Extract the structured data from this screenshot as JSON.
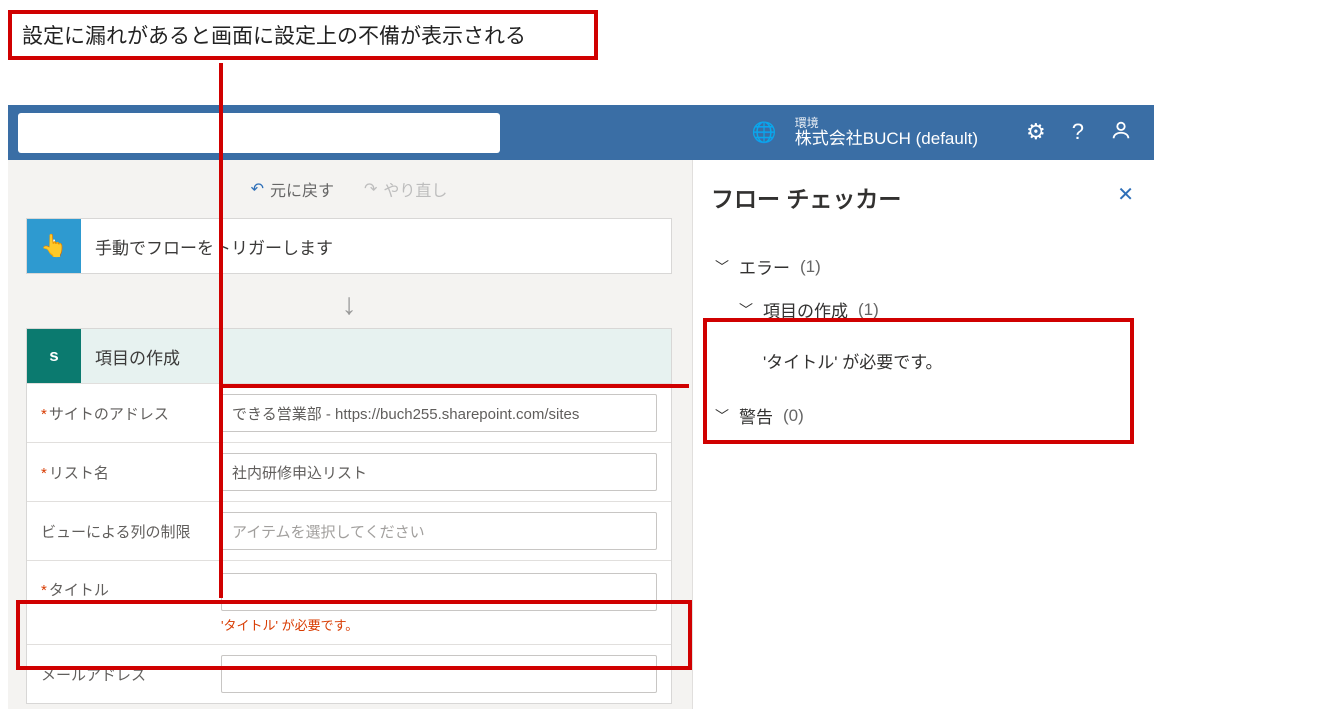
{
  "annotation": {
    "text": "設定に漏れがあると画面に設定上の不備が表示される"
  },
  "header": {
    "env_label": "環境",
    "env_value": "株式会社BUCH (default)"
  },
  "toolbar": {
    "undo": "元に戻す",
    "redo": "やり直し"
  },
  "trigger": {
    "title": "手動でフローをトリガーします"
  },
  "createItem": {
    "title": "項目の作成",
    "fields": {
      "site_label": "サイトのアドレス",
      "site_value": "できる営業部 - https://buch255.sharepoint.com/sites",
      "list_label": "リスト名",
      "list_value": "社内研修申込リスト",
      "view_label": "ビューによる列の制限",
      "view_placeholder": "アイテムを選択してください",
      "title_label": "タイトル",
      "title_error": "'タイトル' が必要です。",
      "email_label": "メールアドレス"
    }
  },
  "checker": {
    "title": "フロー チェッカー",
    "errors_label": "エラー",
    "errors_count": "(1)",
    "error_item_label": "項目の作成",
    "error_item_count": "(1)",
    "error_msg": "'タイトル' が必要です。",
    "warnings_label": "警告",
    "warnings_count": "(0)"
  }
}
